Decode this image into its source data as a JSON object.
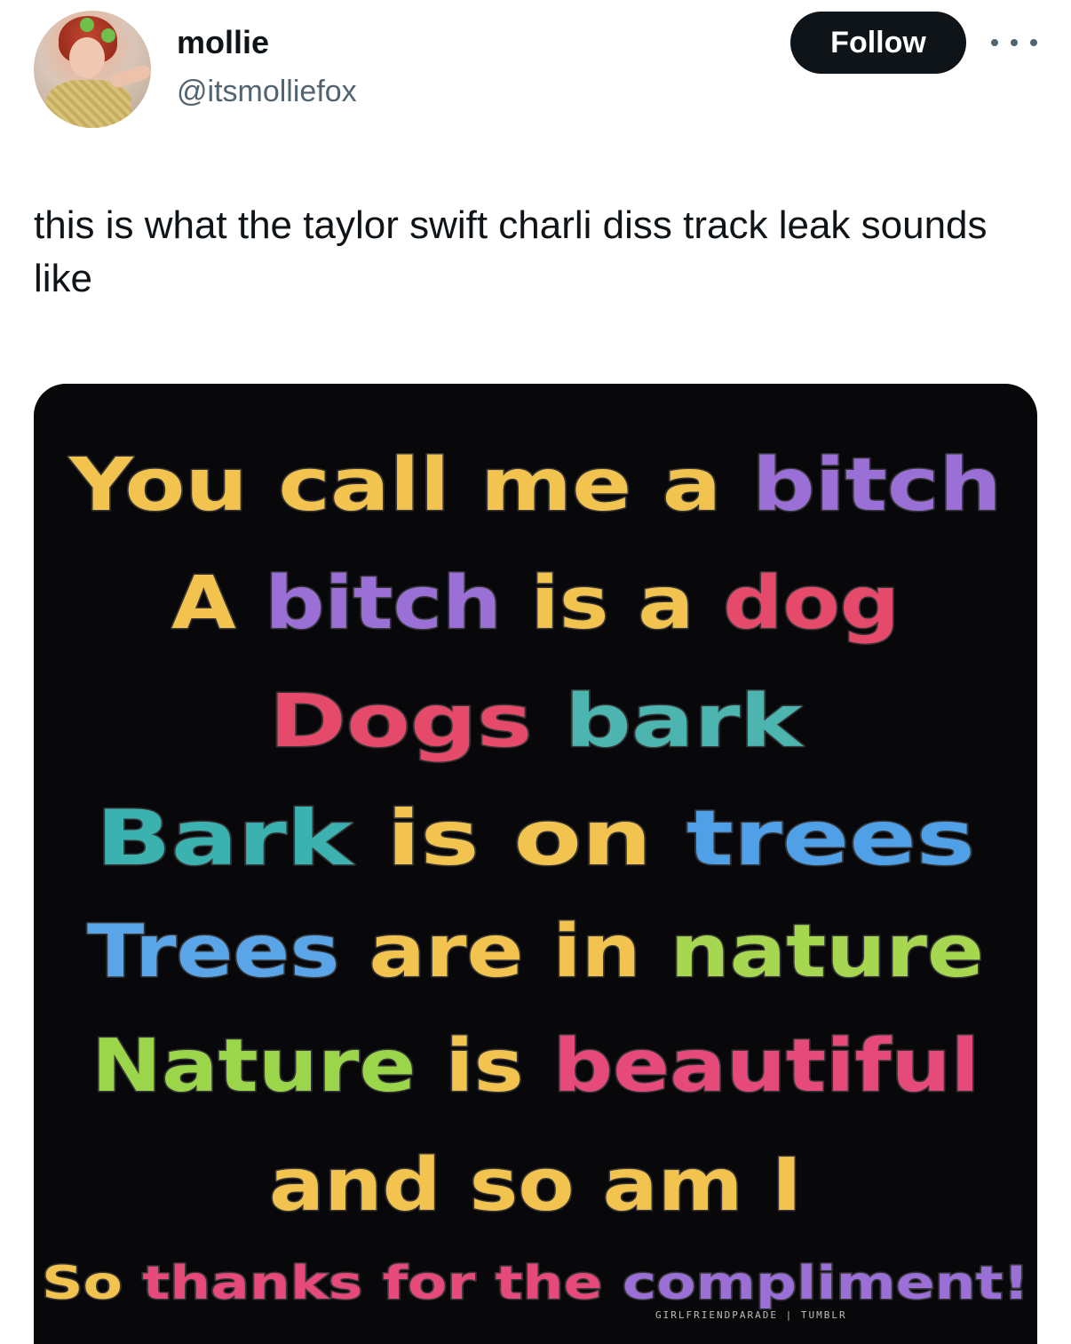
{
  "tweet": {
    "display_name": "mollie",
    "handle": "@itsmolliefox",
    "follow_label": "Follow",
    "text": "this is what the taylor swift charli diss track leak sounds like"
  },
  "meme": {
    "lines": [
      [
        {
          "t": "You call me a ",
          "c": "#f2c34e"
        },
        {
          "t": "bitch",
          "c": "#9a70d6"
        }
      ],
      [
        {
          "t": "A ",
          "c": "#f2c34e"
        },
        {
          "t": "bitch",
          "c": "#9a70d6"
        },
        {
          "t": " is a ",
          "c": "#f2c34e"
        },
        {
          "t": "dog",
          "c": "#e64a6a"
        }
      ],
      [
        {
          "t": "Dogs ",
          "c": "#e64a6a"
        },
        {
          "t": "bark",
          "c": "#4cb5b0"
        }
      ],
      [
        {
          "t": "Bark ",
          "c": "#3cb2b0"
        },
        {
          "t": "is on ",
          "c": "#f2c34e"
        },
        {
          "t": "trees",
          "c": "#4fa0e6"
        }
      ],
      [
        {
          "t": "Trees ",
          "c": "#5aa5e8"
        },
        {
          "t": "are in ",
          "c": "#f2c34e"
        },
        {
          "t": "nature",
          "c": "#a7d650"
        }
      ],
      [
        {
          "t": "Nature ",
          "c": "#9bd64a"
        },
        {
          "t": "is ",
          "c": "#f2c34e"
        },
        {
          "t": "beautiful",
          "c": "#e64a7a"
        }
      ],
      [
        {
          "t": "and so am I",
          "c": "#f2c34e"
        }
      ],
      [
        {
          "t": "So ",
          "c": "#f2c34e"
        },
        {
          "t": "thanks for the ",
          "c": "#e64a7a"
        },
        {
          "t": "compliment!",
          "c": "#9a70d6"
        }
      ]
    ],
    "watermark": "GIRLFRIENDPARADE | TUMBLR"
  }
}
